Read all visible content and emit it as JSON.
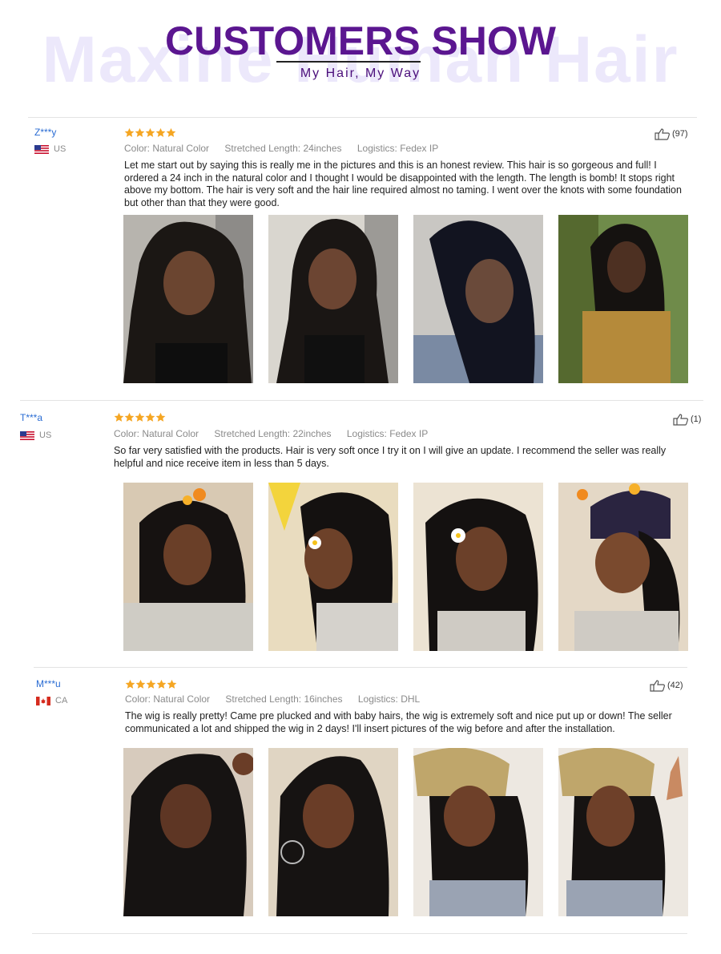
{
  "header": {
    "watermark": "Maxine Human Hair",
    "title": "CUSTOMERS SHOW",
    "subtitle": "My Hair, My Way"
  },
  "reviews": [
    {
      "user": "Z***y",
      "country": "US",
      "rating": 5,
      "color": "Color: Natural Color",
      "length": "Stretched Length: 24inches",
      "logistics": "Logistics: Fedex IP",
      "likes": "(97)",
      "text": "Let me start out by saying this is really me in the pictures and this is an honest review. This hair is so gorgeous and full! I ordered a 24 inch in the natural color and I thought I would be disappointed with the length. The length is bomb! It stops right above my bottom. The hair is very soft and the hair line required almost no taming. I went over the knots with some foundation but other than that they were good.",
      "photos": [
        "customer-photo-1",
        "customer-photo-2",
        "customer-photo-3",
        "customer-photo-4"
      ]
    },
    {
      "user": "T***a",
      "country": "US",
      "rating": 5,
      "color": "Color: Natural Color",
      "length": "Stretched Length: 22inches",
      "logistics": "Logistics: Fedex IP",
      "likes": "(1)",
      "text": "So far very satisfied with the products. Hair is very soft once I try it on I will give an update. I recommend the seller was really helpful and nice receive item in less than 5 days.",
      "photos": [
        "customer-photo-1",
        "customer-photo-2",
        "customer-photo-3",
        "customer-photo-4"
      ]
    },
    {
      "user": "M***u",
      "country": "CA",
      "rating": 5,
      "color": "Color: Natural Color",
      "length": "Stretched Length: 16inches",
      "logistics": "Logistics: DHL",
      "likes": "(42)",
      "text": "The wig is really pretty! Came pre plucked and with baby hairs, the wig is extremely soft and nice put up or down! The seller communicated a lot and shipped the wig in 2 days! I'll insert pictures of the wig before and after the installation.",
      "photos": [
        "customer-photo-1",
        "customer-photo-2",
        "customer-photo-3",
        "customer-photo-4"
      ]
    }
  ],
  "colors": {
    "title": "#5b1690",
    "watermark": "#ece8fb",
    "username": "#2a6cd3",
    "star": "#f5a623"
  }
}
